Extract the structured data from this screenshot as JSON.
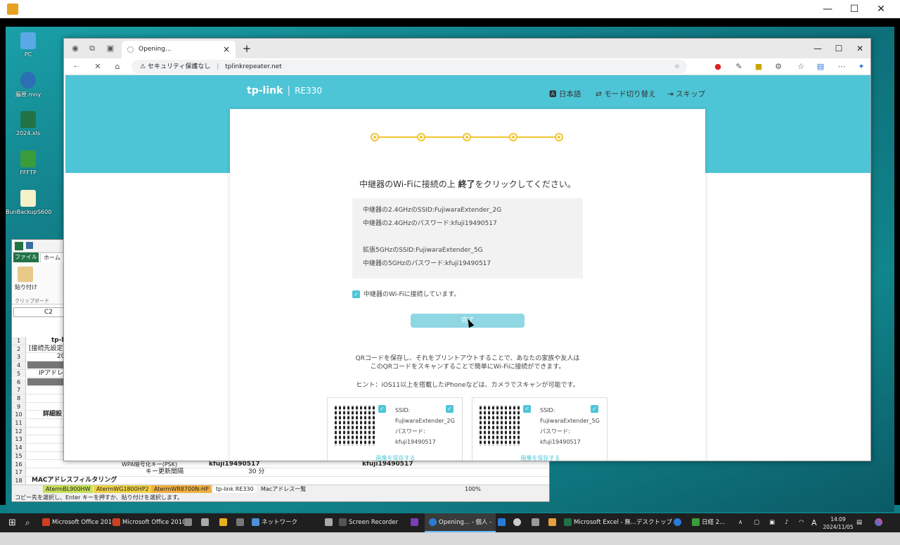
{
  "desktop": {
    "icons": [
      {
        "label": "PC"
      },
      {
        "label": "藤原.mny"
      },
      {
        "label": "2024.xls"
      },
      {
        "label": "FFFTP"
      },
      {
        "label": "BunBackupS600"
      }
    ]
  },
  "excel": {
    "tab_file": "ファイル",
    "tab_home": "ホーム",
    "paste": "貼り付け",
    "clipboard": "クリップボード",
    "namebox": "C2",
    "rows": [
      {
        "n": "1",
        "text": "tp-l"
      },
      {
        "n": "2",
        "text": "[接続先設定"
      },
      {
        "n": "3",
        "text": "20"
      },
      {
        "n": "4",
        "text": ""
      },
      {
        "n": "5",
        "text": "IPアドレ"
      },
      {
        "n": "6",
        "text": ""
      },
      {
        "n": "7",
        "text": ""
      },
      {
        "n": "8",
        "text": ""
      },
      {
        "n": "9",
        "text": ""
      },
      {
        "n": "10",
        "text": "詳細設"
      },
      {
        "n": "11",
        "text": ""
      },
      {
        "n": "12",
        "text": ""
      },
      {
        "n": "13",
        "text": ""
      },
      {
        "n": "14",
        "text": ""
      },
      {
        "n": "15",
        "text": ""
      },
      {
        "n": "16",
        "text": "WPA暗号化キー(PSK)",
        "val": "kfuji19490517",
        "val2": "kfuji19490517"
      },
      {
        "n": "17",
        "text": "キー更新間隔",
        "val": "30 分"
      },
      {
        "n": "18",
        "text": "MACアドレスフィルタリング"
      }
    ],
    "sheets": [
      "AtermBL900HW",
      "AtermWG1800HP2",
      "AtermWR8700N-HP",
      "tp-link RE330",
      "Macアドレス一覧"
    ],
    "status": "コピー先を選択し、Enter キーを押すか、貼り付けを選択します。",
    "zoom": "100%"
  },
  "browser": {
    "tab_title": "Opening...",
    "security": "セキュリティ保護なし",
    "url": "tplinkrepeater.net"
  },
  "page": {
    "brand": "tp-link",
    "model": "RE330",
    "nav": [
      "日本語",
      "モード切り替え",
      "スキップ"
    ],
    "steps_total": 5,
    "instruction_pre": "中継器のWi-Fiに接続の上 ",
    "instruction_bold": "終了",
    "instruction_post": "をクリックしてください。",
    "info": [
      "中継器の2.4GHzのSSID:FujiwaraExtender_2G",
      "中継器の2.4GHzのパスワード:kfuji19490517",
      "",
      "拡張5GHzのSSID:FujiwaraExtender_5G",
      "中継器の5GHzのパスワード:kfuji19490517"
    ],
    "checkbox_label": "中継器のWi-Fiに接続しています。",
    "done_button": "完了",
    "qr_text_1": "QRコードを保存し、それをプリントアウトすることで、あなたの家族や友人は",
    "qr_text_2": "このQRコードをスキャンすることで簡単にWi-Fiに接続ができます。",
    "hint": "ヒント：iOS11以上を搭載したiPhoneなどは、カメラでスキャンが可能です。",
    "qr_cards": [
      {
        "ssid_label": "SSID:",
        "ssid": "FujiwaraExtender_2G",
        "pw_label": "パスワード:",
        "pw": "kfuji19490517",
        "save": "画像を保存する"
      },
      {
        "ssid_label": "SSID:",
        "ssid": "FujiwaraExtender_5G",
        "pw_label": "パスワード:",
        "pw": "kfuji19490517",
        "save": "画像を保存する"
      }
    ]
  },
  "taskbar": {
    "items": [
      "Microsoft Office 2010",
      "Microsoft Office 2010",
      "ネットワーク",
      "Screen Recorder",
      "Opening... - 個人 -",
      "Microsoft Excel - 無...",
      "デスクトップ",
      "日経 2..."
    ],
    "time": "14:09",
    "date": "2024/11/05",
    "ime": "A"
  },
  "colors": {
    "teal": "#4ec5d6",
    "step_yellow": "#f2c531",
    "button_disabled": "#8fd7e3"
  }
}
